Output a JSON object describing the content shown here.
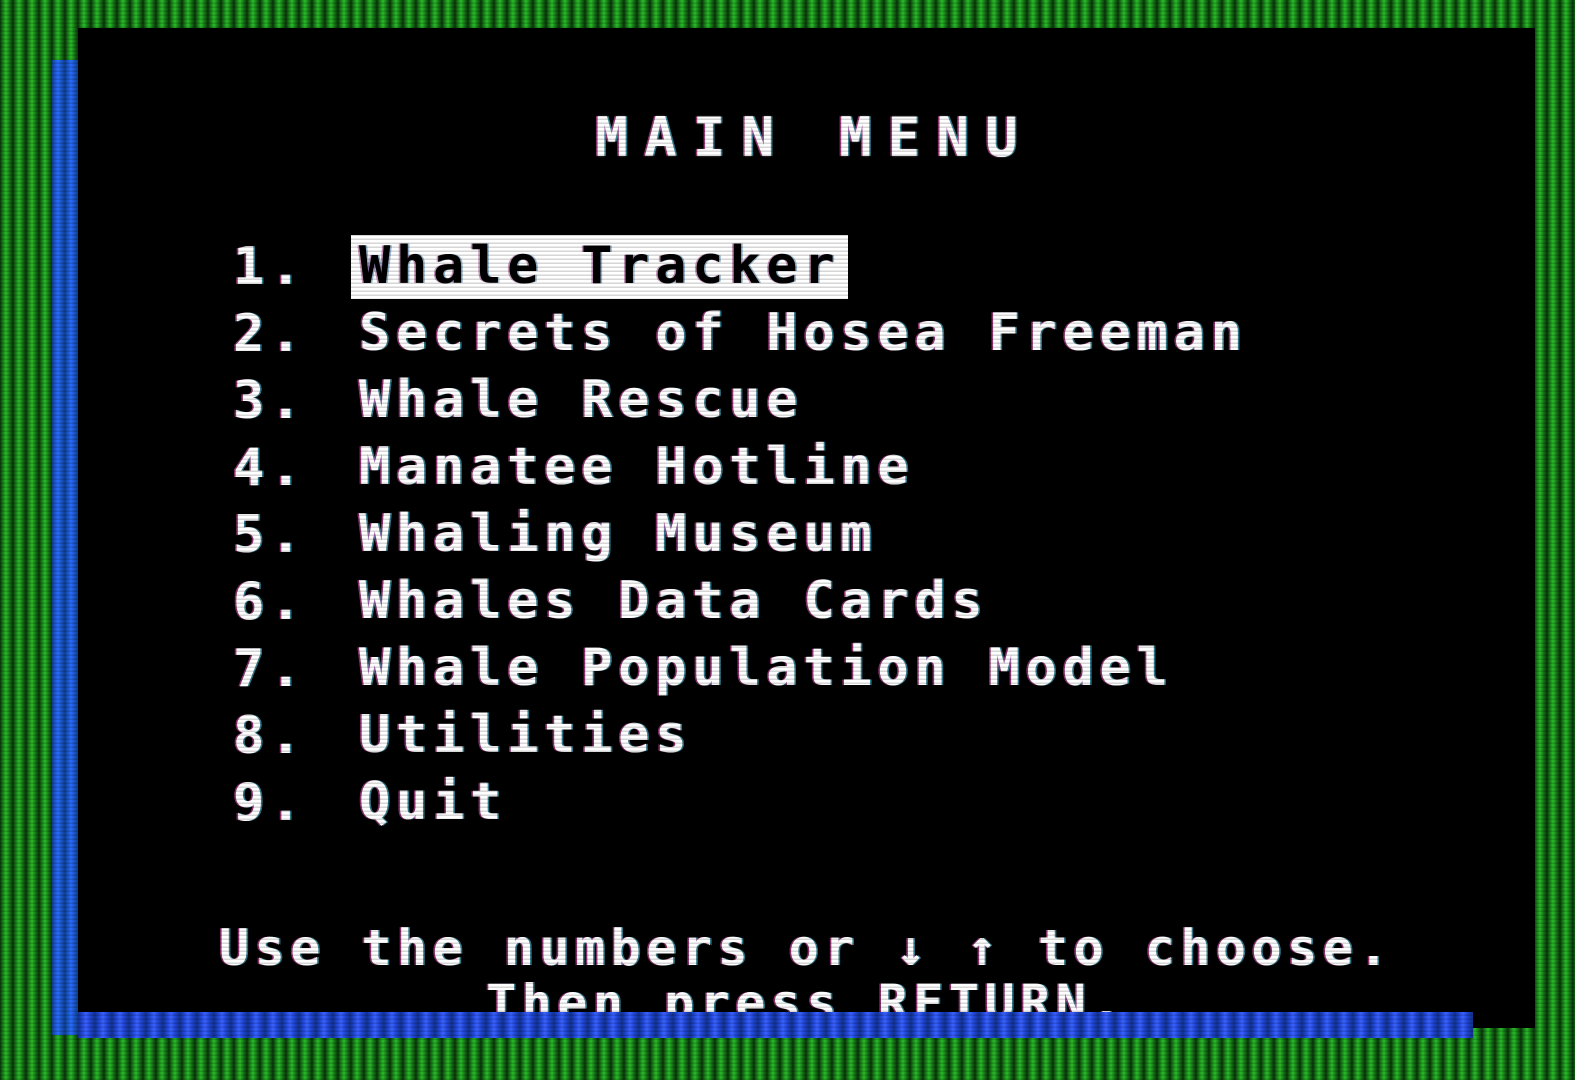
{
  "screen": {
    "title": "MAIN MENU",
    "colors": {
      "border_green_bright": "#27bd27",
      "border_green_dark": "#093409",
      "artifact_blue": "#2b6bff",
      "screen_black": "#000000",
      "text_white": "#ffffff"
    }
  },
  "menu": {
    "items": [
      {
        "number": "1.",
        "label": "Whale Tracker",
        "selected": true
      },
      {
        "number": "2.",
        "label": "Secrets of Hosea Freeman",
        "selected": false
      },
      {
        "number": "3.",
        "label": "Whale Rescue",
        "selected": false
      },
      {
        "number": "4.",
        "label": "Manatee Hotline",
        "selected": false
      },
      {
        "number": "5.",
        "label": "Whaling Museum",
        "selected": false
      },
      {
        "number": "6.",
        "label": "Whales Data Cards",
        "selected": false
      },
      {
        "number": "7.",
        "label": "Whale Population Model",
        "selected": false
      },
      {
        "number": "8.",
        "label": "Utilities",
        "selected": false
      },
      {
        "number": "9.",
        "label": "Quit",
        "selected": false
      }
    ]
  },
  "footer": {
    "line1": "Use the numbers or ↓ ↑ to choose.",
    "line2": "Then press RETURN.",
    "down_arrow": "↓",
    "up_arrow": "↑"
  }
}
